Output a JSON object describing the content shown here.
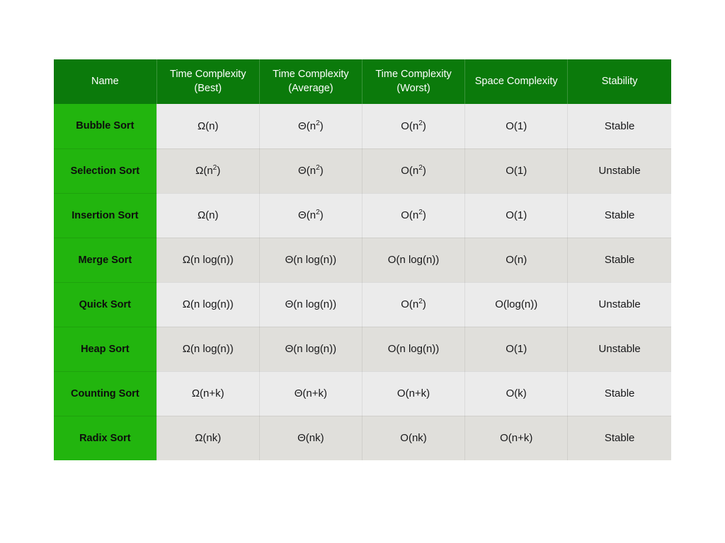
{
  "table": {
    "headers": [
      "Name",
      "Time Complexity (Best)",
      "Time Complexity (Average)",
      "Time Complexity (Worst)",
      "Space Complexity",
      "Stability"
    ],
    "header_lines": [
      [
        "Name"
      ],
      [
        "Time Complexity",
        "(Best)"
      ],
      [
        "Time Complexity",
        "(Average)"
      ],
      [
        "Time Complexity",
        "(Worst)"
      ],
      [
        "Space Complexity"
      ],
      [
        "Stability"
      ]
    ],
    "rows": [
      {
        "name": "Bubble Sort",
        "best": "Ω(n)",
        "average": "Θ(n²)",
        "worst": "O(n²)",
        "space": "O(1)",
        "stability": "Stable"
      },
      {
        "name": "Selection Sort",
        "best": "Ω(n²)",
        "average": "Θ(n²)",
        "worst": "O(n²)",
        "space": "O(1)",
        "stability": "Unstable"
      },
      {
        "name": "Insertion Sort",
        "best": "Ω(n)",
        "average": "Θ(n²)",
        "worst": "O(n²)",
        "space": "O(1)",
        "stability": "Stable"
      },
      {
        "name": "Merge Sort",
        "best": "Ω(n log(n))",
        "average": "Θ(n log(n))",
        "worst": "O(n log(n))",
        "space": "O(n)",
        "stability": "Stable"
      },
      {
        "name": "Quick Sort",
        "best": "Ω(n log(n))",
        "average": "Θ(n log(n))",
        "worst": "O(n²)",
        "space": "O(log(n))",
        "stability": "Unstable"
      },
      {
        "name": "Heap Sort",
        "best": "Ω(n log(n))",
        "average": "Θ(n log(n))",
        "worst": "O(n log(n))",
        "space": "O(1)",
        "stability": "Unstable"
      },
      {
        "name": "Counting Sort",
        "best": "Ω(n+k)",
        "average": "Θ(n+k)",
        "worst": "O(n+k)",
        "space": "O(k)",
        "stability": "Stable"
      },
      {
        "name": "Radix Sort",
        "best": "Ω(nk)",
        "average": "Θ(nk)",
        "worst": "O(nk)",
        "space": "O(n+k)",
        "stability": "Stable"
      }
    ]
  },
  "colors": {
    "header_green": "#0b7a0b",
    "name_green": "#22b50e",
    "row_light": "#ebebeb",
    "row_dark": "#e0dfdb",
    "page_background": "#ffffff",
    "header_text": "#ffffff",
    "body_text": "#18181a"
  }
}
